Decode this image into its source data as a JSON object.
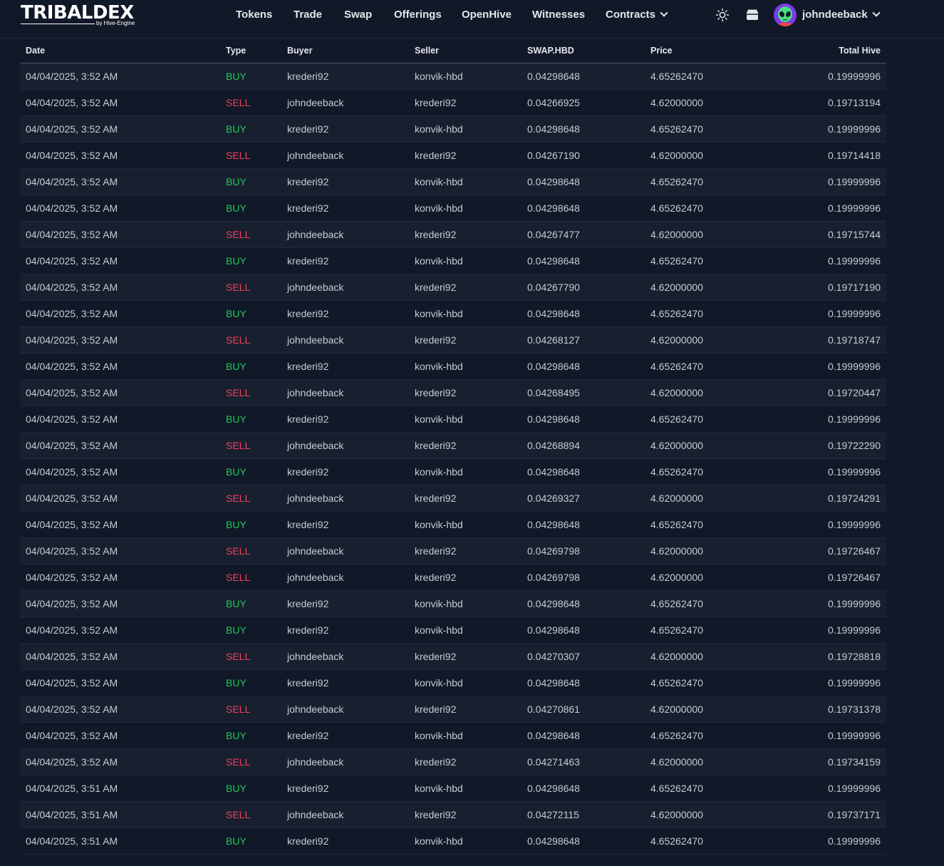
{
  "brand": {
    "name": "TRIBALDEX",
    "byline": "by Hive-Engine"
  },
  "nav": {
    "items": [
      "Tokens",
      "Trade",
      "Swap",
      "Offerings",
      "OpenHive",
      "Witnesses",
      "Contracts"
    ]
  },
  "user": {
    "name": "johndeeback"
  },
  "table": {
    "columns": [
      "Date",
      "Type",
      "Buyer",
      "Seller",
      "SWAP.HBD",
      "Price",
      "Total Hive"
    ],
    "rows": [
      [
        "04/04/2025, 3:52 AM",
        "BUY",
        "krederi92",
        "konvik-hbd",
        "0.04298648",
        "4.65262470",
        "0.19999996"
      ],
      [
        "04/04/2025, 3:52 AM",
        "SELL",
        "johndeeback",
        "krederi92",
        "0.04266925",
        "4.62000000",
        "0.19713194"
      ],
      [
        "04/04/2025, 3:52 AM",
        "BUY",
        "krederi92",
        "konvik-hbd",
        "0.04298648",
        "4.65262470",
        "0.19999996"
      ],
      [
        "04/04/2025, 3:52 AM",
        "SELL",
        "johndeeback",
        "krederi92",
        "0.04267190",
        "4.62000000",
        "0.19714418"
      ],
      [
        "04/04/2025, 3:52 AM",
        "BUY",
        "krederi92",
        "konvik-hbd",
        "0.04298648",
        "4.65262470",
        "0.19999996"
      ],
      [
        "04/04/2025, 3:52 AM",
        "BUY",
        "krederi92",
        "konvik-hbd",
        "0.04298648",
        "4.65262470",
        "0.19999996"
      ],
      [
        "04/04/2025, 3:52 AM",
        "SELL",
        "johndeeback",
        "krederi92",
        "0.04267477",
        "4.62000000",
        "0.19715744"
      ],
      [
        "04/04/2025, 3:52 AM",
        "BUY",
        "krederi92",
        "konvik-hbd",
        "0.04298648",
        "4.65262470",
        "0.19999996"
      ],
      [
        "04/04/2025, 3:52 AM",
        "SELL",
        "johndeeback",
        "krederi92",
        "0.04267790",
        "4.62000000",
        "0.19717190"
      ],
      [
        "04/04/2025, 3:52 AM",
        "BUY",
        "krederi92",
        "konvik-hbd",
        "0.04298648",
        "4.65262470",
        "0.19999996"
      ],
      [
        "04/04/2025, 3:52 AM",
        "SELL",
        "johndeeback",
        "krederi92",
        "0.04268127",
        "4.62000000",
        "0.19718747"
      ],
      [
        "04/04/2025, 3:52 AM",
        "BUY",
        "krederi92",
        "konvik-hbd",
        "0.04298648",
        "4.65262470",
        "0.19999996"
      ],
      [
        "04/04/2025, 3:52 AM",
        "SELL",
        "johndeeback",
        "krederi92",
        "0.04268495",
        "4.62000000",
        "0.19720447"
      ],
      [
        "04/04/2025, 3:52 AM",
        "BUY",
        "krederi92",
        "konvik-hbd",
        "0.04298648",
        "4.65262470",
        "0.19999996"
      ],
      [
        "04/04/2025, 3:52 AM",
        "SELL",
        "johndeeback",
        "krederi92",
        "0.04268894",
        "4.62000000",
        "0.19722290"
      ],
      [
        "04/04/2025, 3:52 AM",
        "BUY",
        "krederi92",
        "konvik-hbd",
        "0.04298648",
        "4.65262470",
        "0.19999996"
      ],
      [
        "04/04/2025, 3:52 AM",
        "SELL",
        "johndeeback",
        "krederi92",
        "0.04269327",
        "4.62000000",
        "0.19724291"
      ],
      [
        "04/04/2025, 3:52 AM",
        "BUY",
        "krederi92",
        "konvik-hbd",
        "0.04298648",
        "4.65262470",
        "0.19999996"
      ],
      [
        "04/04/2025, 3:52 AM",
        "SELL",
        "johndeeback",
        "krederi92",
        "0.04269798",
        "4.62000000",
        "0.19726467"
      ],
      [
        "04/04/2025, 3:52 AM",
        "SELL",
        "johndeeback",
        "krederi92",
        "0.04269798",
        "4.62000000",
        "0.19726467"
      ],
      [
        "04/04/2025, 3:52 AM",
        "BUY",
        "krederi92",
        "konvik-hbd",
        "0.04298648",
        "4.65262470",
        "0.19999996"
      ],
      [
        "04/04/2025, 3:52 AM",
        "BUY",
        "krederi92",
        "konvik-hbd",
        "0.04298648",
        "4.65262470",
        "0.19999996"
      ],
      [
        "04/04/2025, 3:52 AM",
        "SELL",
        "johndeeback",
        "krederi92",
        "0.04270307",
        "4.62000000",
        "0.19728818"
      ],
      [
        "04/04/2025, 3:52 AM",
        "BUY",
        "krederi92",
        "konvik-hbd",
        "0.04298648",
        "4.65262470",
        "0.19999996"
      ],
      [
        "04/04/2025, 3:52 AM",
        "SELL",
        "johndeeback",
        "krederi92",
        "0.04270861",
        "4.62000000",
        "0.19731378"
      ],
      [
        "04/04/2025, 3:52 AM",
        "BUY",
        "krederi92",
        "konvik-hbd",
        "0.04298648",
        "4.65262470",
        "0.19999996"
      ],
      [
        "04/04/2025, 3:52 AM",
        "SELL",
        "johndeeback",
        "krederi92",
        "0.04271463",
        "4.62000000",
        "0.19734159"
      ],
      [
        "04/04/2025, 3:51 AM",
        "BUY",
        "krederi92",
        "konvik-hbd",
        "0.04298648",
        "4.65262470",
        "0.19999996"
      ],
      [
        "04/04/2025, 3:51 AM",
        "SELL",
        "johndeeback",
        "krederi92",
        "0.04272115",
        "4.62000000",
        "0.19737171"
      ],
      [
        "04/04/2025, 3:51 AM",
        "BUY",
        "krederi92",
        "konvik-hbd",
        "0.04298648",
        "4.65262470",
        "0.19999996"
      ]
    ]
  },
  "icons": {
    "theme": "sun-icon",
    "wallet": "wallet-icon",
    "avatar": "alien-avatar",
    "dropdown": "chevron-down-icon"
  },
  "colors": {
    "background": "#111827",
    "buy": "#22c55e",
    "sell": "#f43f5e",
    "avatar_bg": "#7c3aed"
  }
}
